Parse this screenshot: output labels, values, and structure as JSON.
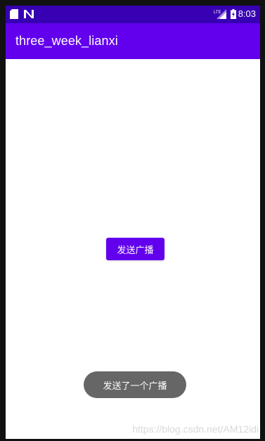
{
  "status_bar": {
    "time": "8:03",
    "network_label": "LTE",
    "icons": [
      "sd-card-icon",
      "n-notification-icon",
      "lte-signal-icon",
      "battery-charging-icon"
    ]
  },
  "app_bar": {
    "title": "three_week_lianxi"
  },
  "main": {
    "send_broadcast_button": "发送广播"
  },
  "toast": {
    "message": "发送了一个广播"
  },
  "watermark": {
    "text": "https://blog.csdn.net/AM12idi"
  },
  "colors": {
    "status_bar": "#3700b3",
    "app_bar": "#6200ee",
    "button": "#6200ee",
    "toast": "#666666"
  }
}
